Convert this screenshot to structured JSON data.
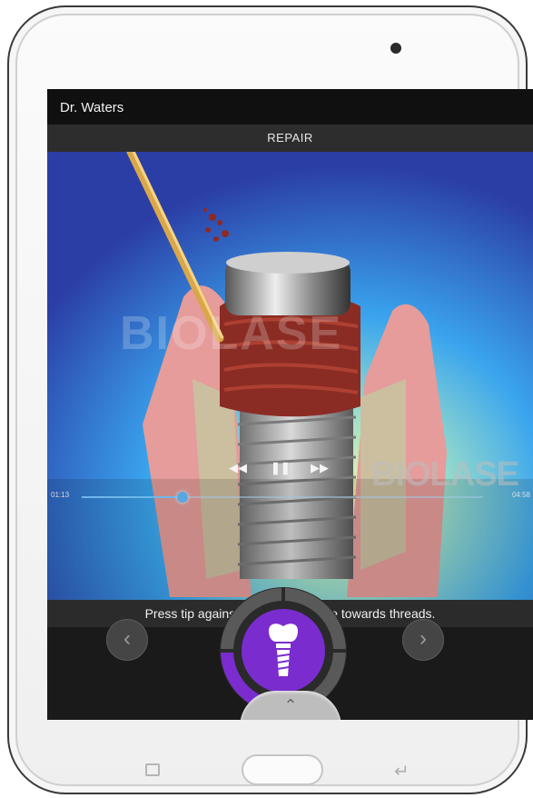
{
  "header": {
    "user_name": "Dr. Waters",
    "section_title": "REPAIR"
  },
  "video": {
    "watermark_center": "BIOLASE",
    "watermark_corner": "BIOLASE",
    "elapsed_time": "01:13",
    "total_time": "04:58",
    "progress": 0.25,
    "controls": {
      "rewind_icon": "rewind-icon",
      "pause_icon": "pause-icon",
      "forward_icon": "fast-forward-icon"
    }
  },
  "caption": "Press tip against soft tissue, angle towards threads.",
  "navigation": {
    "prev_icon": "chevron-left-icon",
    "next_icon": "chevron-right-icon"
  },
  "dial": {
    "icon": "dental-implant-icon",
    "progress_segments_filled": 1,
    "progress_segments_total": 4,
    "accent_color": "#7b2ccf"
  },
  "device_keys": {
    "recent": "recent-apps-icon",
    "home": "home-button",
    "back": "back-icon"
  }
}
